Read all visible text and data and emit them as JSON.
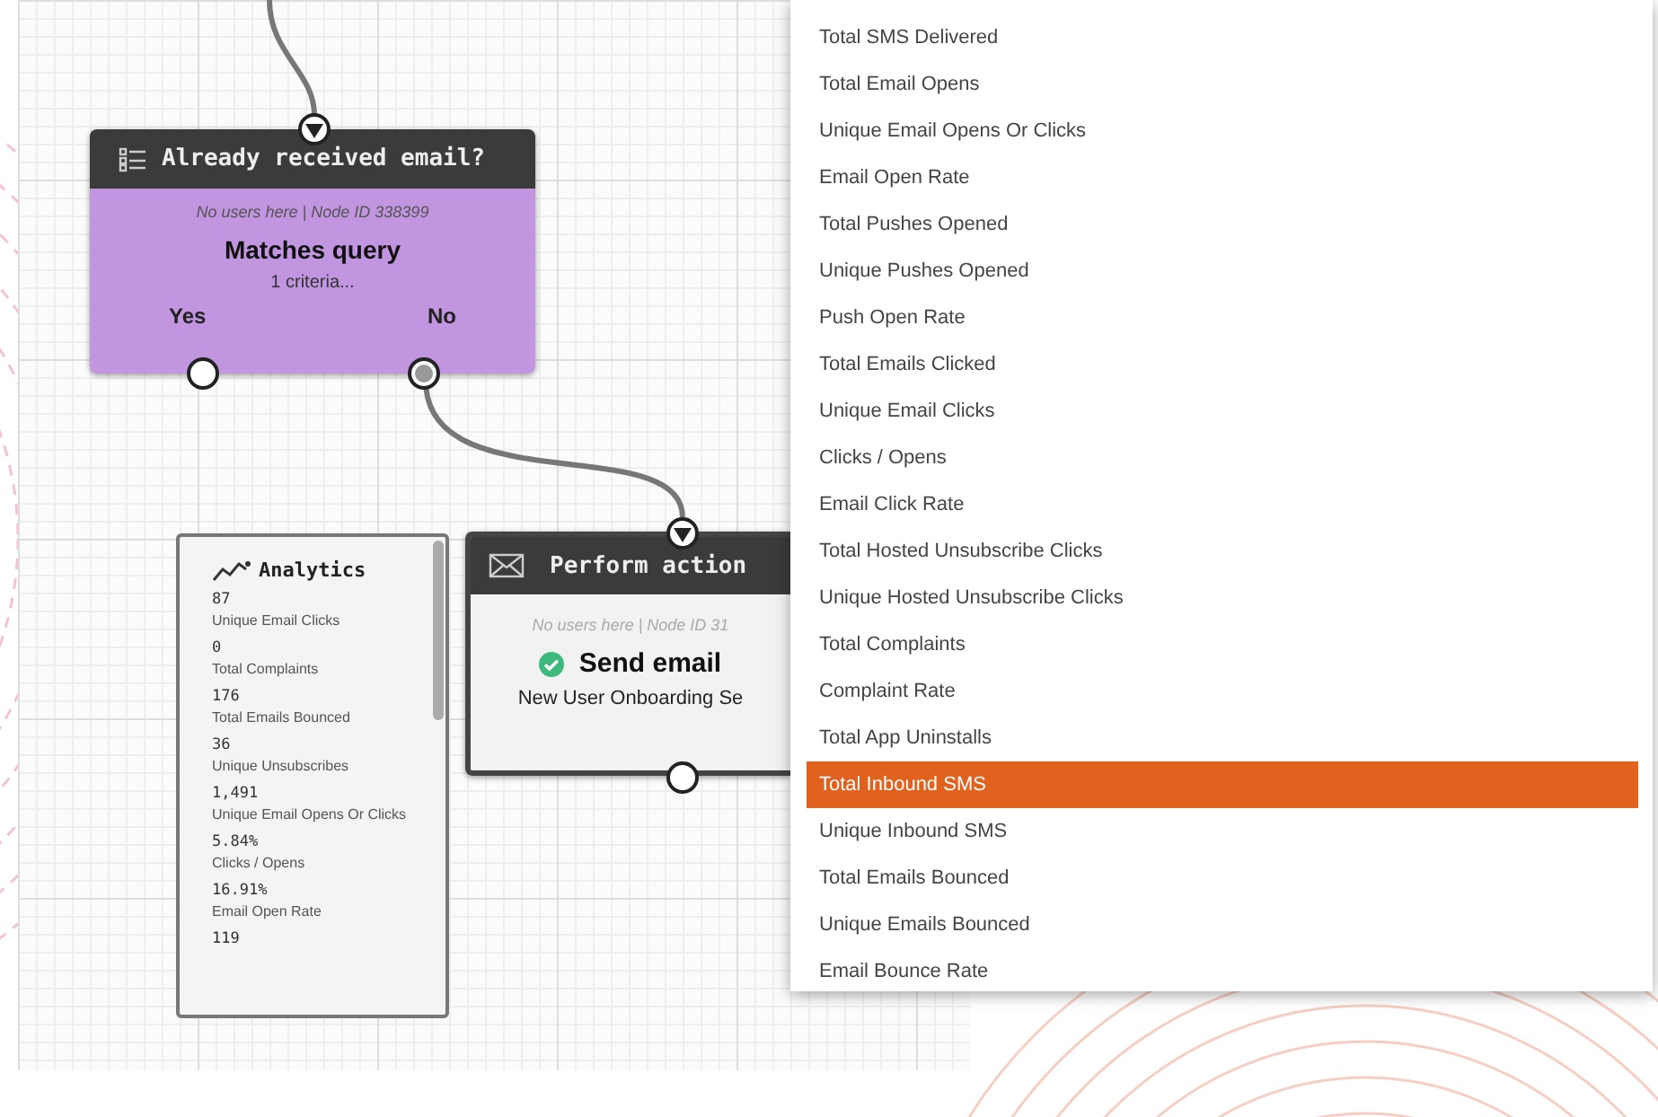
{
  "condition_node": {
    "title": "Already received email?",
    "meta": "No users here | Node ID 338399",
    "heading": "Matches query",
    "detail": "1 criteria...",
    "branches": [
      "Yes",
      "No"
    ]
  },
  "analytics": {
    "title": "Analytics",
    "stats": [
      {
        "value": "87",
        "label": "Unique Email Clicks"
      },
      {
        "value": "0",
        "label": "Total Complaints"
      },
      {
        "value": "176",
        "label": "Total Emails Bounced"
      },
      {
        "value": "36",
        "label": "Unique Unsubscribes"
      },
      {
        "value": "1,491",
        "label": "Unique Email Opens Or Clicks"
      },
      {
        "value": "5.84%",
        "label": "Clicks / Opens"
      },
      {
        "value": "16.91%",
        "label": "Email Open Rate"
      },
      {
        "value": "119"
      }
    ]
  },
  "action_node": {
    "title": "Perform action",
    "meta": "No users here | Node ID 31",
    "heading": "Send email",
    "detail": "New User Onboarding Se"
  },
  "metric_menu": {
    "items": [
      {
        "label": "Total SMS Delivered",
        "selected": false
      },
      {
        "label": "Total Email Opens",
        "selected": false
      },
      {
        "label": "Unique Email Opens Or Clicks",
        "selected": false
      },
      {
        "label": "Email Open Rate",
        "selected": false
      },
      {
        "label": "Total Pushes Opened",
        "selected": false
      },
      {
        "label": "Unique Pushes Opened",
        "selected": false
      },
      {
        "label": "Push Open Rate",
        "selected": false
      },
      {
        "label": "Total Emails Clicked",
        "selected": false
      },
      {
        "label": "Unique Email Clicks",
        "selected": false
      },
      {
        "label": "Clicks / Opens",
        "selected": false
      },
      {
        "label": "Email Click Rate",
        "selected": false
      },
      {
        "label": "Total Hosted Unsubscribe Clicks",
        "selected": false
      },
      {
        "label": "Unique Hosted Unsubscribe Clicks",
        "selected": false
      },
      {
        "label": "Total Complaints",
        "selected": false
      },
      {
        "label": "Complaint Rate",
        "selected": false
      },
      {
        "label": "Total App Uninstalls",
        "selected": false
      },
      {
        "label": "Total Inbound SMS",
        "selected": true
      },
      {
        "label": "Unique Inbound SMS",
        "selected": false
      },
      {
        "label": "Total Emails Bounced",
        "selected": false
      },
      {
        "label": "Unique Emails Bounced",
        "selected": false
      },
      {
        "label": "Email Bounce Rate",
        "selected": false
      }
    ]
  }
}
